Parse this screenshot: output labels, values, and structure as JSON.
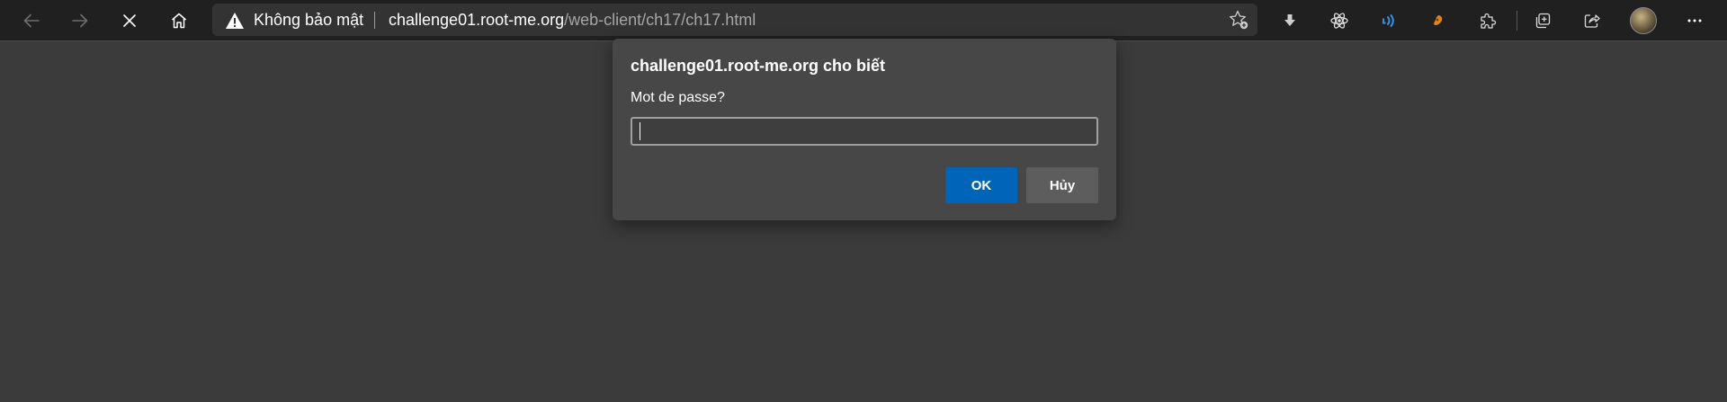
{
  "toolbar": {
    "back_icon": "back-arrow-icon",
    "forward_icon": "forward-arrow-icon",
    "stop_icon": "stop-loading-icon",
    "home_icon": "home-icon",
    "extensions": [
      "download-icon",
      "react-devtools-icon",
      "read-aloud-icon",
      "extension-icon",
      "extensions-puzzle-icon"
    ],
    "collections_icon": "collections-icon",
    "share_icon": "share-icon",
    "menu_icon": "more-menu-icon"
  },
  "address_bar": {
    "security_label": "Không bảo mật",
    "url_host": "challenge01.root-me.org",
    "url_path": "/web-client/ch17/ch17.html"
  },
  "dialog": {
    "title": "challenge01.root-me.org cho biết",
    "message": "Mot de passe?",
    "input_value": "",
    "ok_label": "OK",
    "cancel_label": "Hủy"
  },
  "colors": {
    "page_background": "#3b3b3b",
    "toolbar_background": "#202020",
    "dialog_background": "#474747",
    "ok_button": "#0064b9",
    "cancel_button": "#5d5d5d",
    "read_aloud_icon": "#3a8fe0",
    "extension_icon": "#e0821f"
  }
}
